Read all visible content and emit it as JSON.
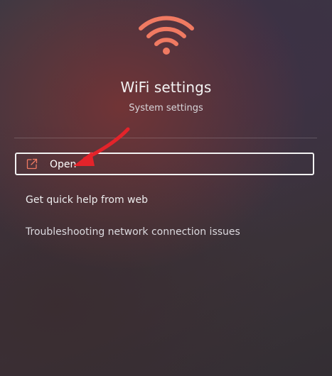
{
  "header": {
    "icon": "wifi-icon",
    "title": "WiFi settings",
    "subtitle": "System settings"
  },
  "actions": {
    "open": {
      "label": "Open",
      "icon": "open-external-icon"
    },
    "links": [
      {
        "label": "Get quick help from web"
      },
      {
        "label": "Troubleshooting network connection issues"
      }
    ]
  },
  "annotation": {
    "icon": "red-arrow-icon",
    "color": "#e4232a"
  },
  "colors": {
    "accent": "#f07a62",
    "border": "#f2f2f2"
  }
}
